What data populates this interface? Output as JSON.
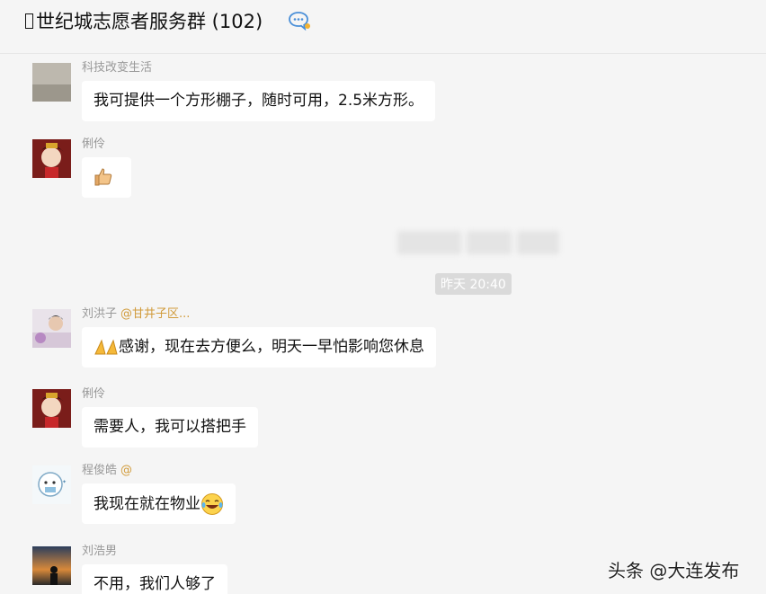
{
  "header": {
    "title": "􀀀世纪城志愿者服务群 (102)",
    "title_text": "世纪城志愿者服务群 (102)",
    "more_icon": "chat-bubble-dots-icon"
  },
  "messages": [
    {
      "sender": "科技改变生活",
      "mention": "",
      "text": "我可提供一个方形棚子，随时可用，2.5米方形。",
      "emoji": ""
    },
    {
      "sender": "俐伶",
      "mention": "",
      "text": "",
      "emoji": "thumbs-up-icon"
    },
    {
      "sender": "刘洪子",
      "mention": "@甘井子区...",
      "text": "感谢，现在去方便么，明天一早怕影响您休息",
      "emoji": "praying-hands-icon"
    },
    {
      "sender": "俐伶",
      "mention": "",
      "text": "需要人，我可以搭把手",
      "emoji": ""
    },
    {
      "sender": "程俊皓",
      "mention": "@",
      "text": "我现在就在物业",
      "emoji": "laughing-tears-icon"
    },
    {
      "sender": "刘浩男",
      "mention": "",
      "text": "不用，我们人够了",
      "emoji": ""
    }
  ],
  "timestamp": "昨天 20:40",
  "watermark": "头条 @大连发布",
  "colors": {
    "background": "#f5f5f5",
    "bubble": "#ffffff",
    "mention": "#d19b3b",
    "timestamp_bg": "#dadada"
  }
}
